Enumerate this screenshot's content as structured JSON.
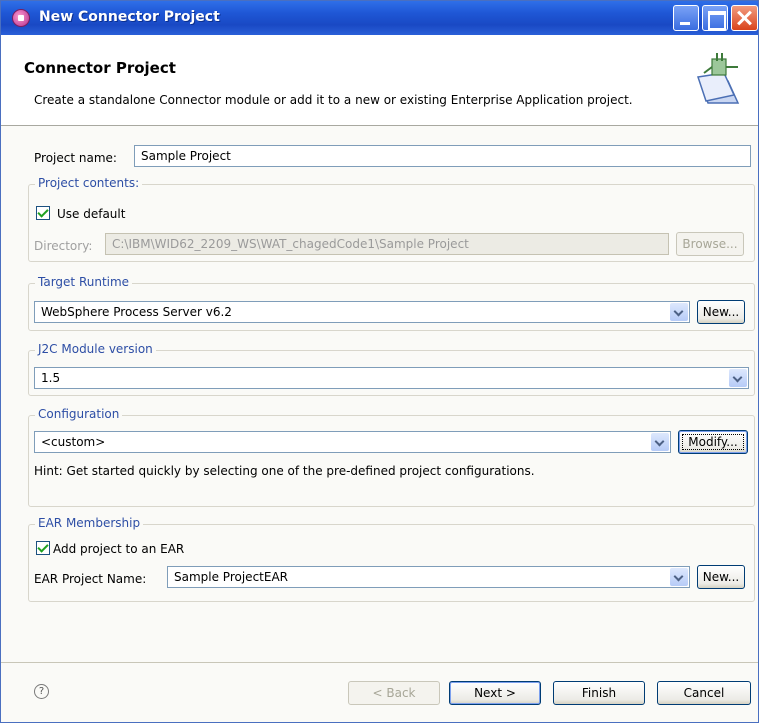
{
  "window": {
    "title": "New Connector Project"
  },
  "banner": {
    "title": "Connector Project",
    "description": "Create a standalone Connector module or add it to a new or existing Enterprise Application project."
  },
  "project_name": {
    "label": "Project name:",
    "value": "Sample Project"
  },
  "project_contents": {
    "legend": "Project contents:",
    "use_default_label": "Use default",
    "use_default_checked": true,
    "directory_label": "Directory:",
    "directory_value": "C:\\IBM\\WID62_2209_WS\\WAT_chagedCode1\\Sample Project",
    "browse_label": "Browse..."
  },
  "target_runtime": {
    "legend": "Target Runtime",
    "value": "WebSphere Process Server v6.2",
    "new_label": "New..."
  },
  "j2c_module": {
    "legend": "J2C Module version",
    "value": "1.5"
  },
  "configuration": {
    "legend": "Configuration",
    "value": "<custom>",
    "modify_label": "Modify...",
    "hint": "Hint: Get started quickly by selecting one of the pre-defined project configurations."
  },
  "ear_membership": {
    "legend": "EAR Membership",
    "add_label": "Add project to an EAR",
    "add_checked": true,
    "ear_name_label": "EAR Project Name:",
    "ear_name_value": "Sample ProjectEAR",
    "new_label": "New..."
  },
  "footer": {
    "help_symbol": "?",
    "back_label": "< Back",
    "next_label": "Next >",
    "finish_label": "Finish",
    "cancel_label": "Cancel"
  },
  "colors": {
    "titlebar": "#1f57d6",
    "group_legend": "#2d4ea5",
    "check": "#21a121"
  }
}
